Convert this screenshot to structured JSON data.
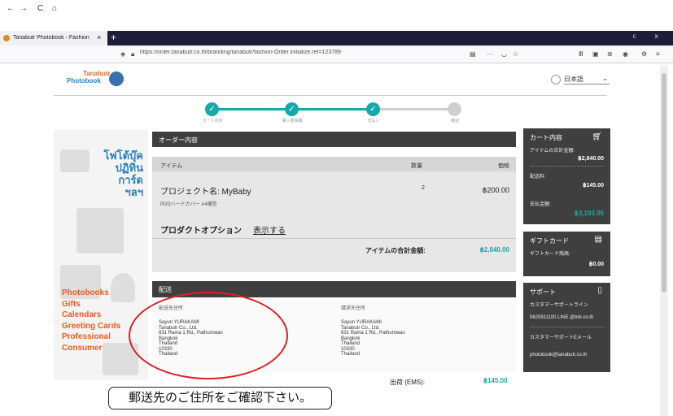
{
  "browser": {
    "tab_title": "Tanabutr Photobook ‐ Fashion ‐ Order",
    "tab_close": "×",
    "new_tab": "+",
    "url": "https://order.tanabutr.co.th/branding/tanabutr/fashion-Order.initialize.ref=123789",
    "nav_back": "←",
    "nav_forward": "→",
    "nav_reload": "C",
    "nav_home": "⌂",
    "star": "☆",
    "menu": "≡"
  },
  "header": {
    "logo_line1": "Tanabutr",
    "logo_line2": "Photobook",
    "language": "日本語"
  },
  "stepper": {
    "steps": [
      {
        "label": "カート内容",
        "done": true
      },
      {
        "label": "購入者情報",
        "done": true
      },
      {
        "label": "支払い",
        "done": true
      },
      {
        "label": "確認",
        "done": false
      }
    ]
  },
  "promo": {
    "thai_text": [
      "โฟโต้บุ๊ค",
      "ปฏิทิน",
      "การ์ด",
      "ฯลฯ"
    ],
    "links": [
      "Photobooks",
      "Gifts",
      "Calendars",
      "Greeting Cards",
      "Professional",
      "Consumer"
    ]
  },
  "order": {
    "section_title": "オーダー内容",
    "col_item": "アイテム",
    "col_qty": "数量",
    "col_price": "価格",
    "project_name": "プロジェクト名: MyBaby",
    "project_sub": "PDDハードカバー A4横型",
    "qty": "2",
    "price": "฿200.00",
    "options_label": "プロダクトオプション",
    "options_link": "表示する",
    "subtotal_label": "アイテムの合計金額:",
    "subtotal_value": "฿2,840.00"
  },
  "shipping": {
    "section_title": "配送",
    "ship_to_label": "配送先住所",
    "bill_to_label": "請求先住所",
    "ship_lines": [
      "Sayun YURAKAMI",
      "Tanabutr Co., Ltd.",
      "831 Rama 1 Rd., Pathumwan",
      "Bangkok",
      "Thailand",
      "10330",
      "Thailand"
    ],
    "bill_lines": [
      "Sayun YURAKAMI",
      "Tanabutr Co., Ltd.",
      "831 Rama 1 Rd., Pathumwan",
      "Bangkok",
      "Thailand",
      "10330",
      "Thailand"
    ],
    "fee_label": "出荷 (EMS):",
    "fee_value": "฿145.00"
  },
  "cart_summary": {
    "title": "カート内容",
    "items_label": "アイテムの合計金額:",
    "items_value": "฿2,840.00",
    "ship_label": "配送料:",
    "ship_value": "฿145.00",
    "total_label": "支払金額:",
    "total_value": "฿3,193.95"
  },
  "gift_card": {
    "title": "ギフトカード",
    "label": "ギフトカード残高:",
    "value": "฿0.00"
  },
  "support": {
    "title": "サポート",
    "line1": "カスタマーサポートライン",
    "line2": "0625911100 LINE @tnb.co.th",
    "line3": "カスタマーサポートEメール",
    "line4": "photobook@tanabutr.co.th"
  },
  "annotation": {
    "callout": "郵送先のご住所をご確認下さい。"
  },
  "colors": {
    "teal": "#16a9a9",
    "orange": "#e85d1c",
    "blue": "#2a7fc1",
    "dark_panel": "#3f3f3f",
    "price_green": "#19a8a0",
    "annotation_red": "#e02020"
  }
}
